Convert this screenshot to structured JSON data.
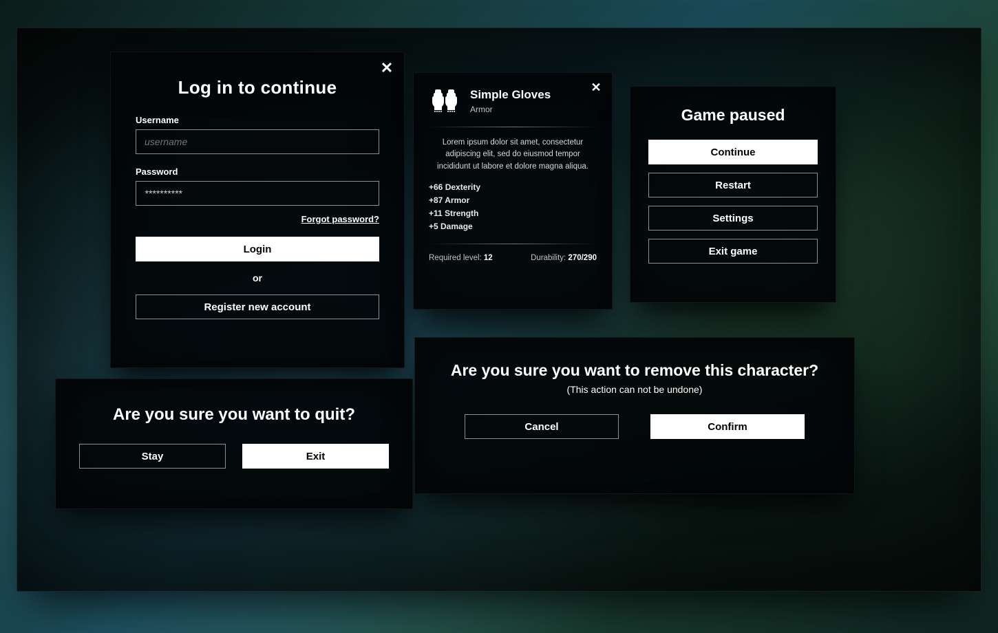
{
  "login": {
    "title": "Log in to continue",
    "username_label": "Username",
    "username_placeholder": "username",
    "password_label": "Password",
    "password_value": "**********",
    "forgot": "Forgot password?",
    "login_btn": "Login",
    "or": "or",
    "register_btn": "Register new account"
  },
  "item": {
    "name": "Simple Gloves",
    "category": "Armor",
    "description": "Lorem ipsum dolor sit amet, consectetur adipiscing elit, sed do eiusmod tempor incididunt ut labore et dolore magna aliqua.",
    "stats": [
      "+66 Dexterity",
      "+87 Armor",
      "+11 Strength",
      "+5 Damage"
    ],
    "req_label": "Required level: ",
    "req_value": "12",
    "dur_label": "Durability: ",
    "dur_value": "270/290"
  },
  "pause": {
    "title": "Game paused",
    "continue": "Continue",
    "restart": "Restart",
    "settings": "Settings",
    "exit": "Exit game"
  },
  "quit": {
    "title": "Are you sure you want to quit?",
    "stay": "Stay",
    "exit": "Exit"
  },
  "remove": {
    "title": "Are you sure you want to remove this character?",
    "subtitle": "(This action can not be undone)",
    "cancel": "Cancel",
    "confirm": "Confirm"
  }
}
